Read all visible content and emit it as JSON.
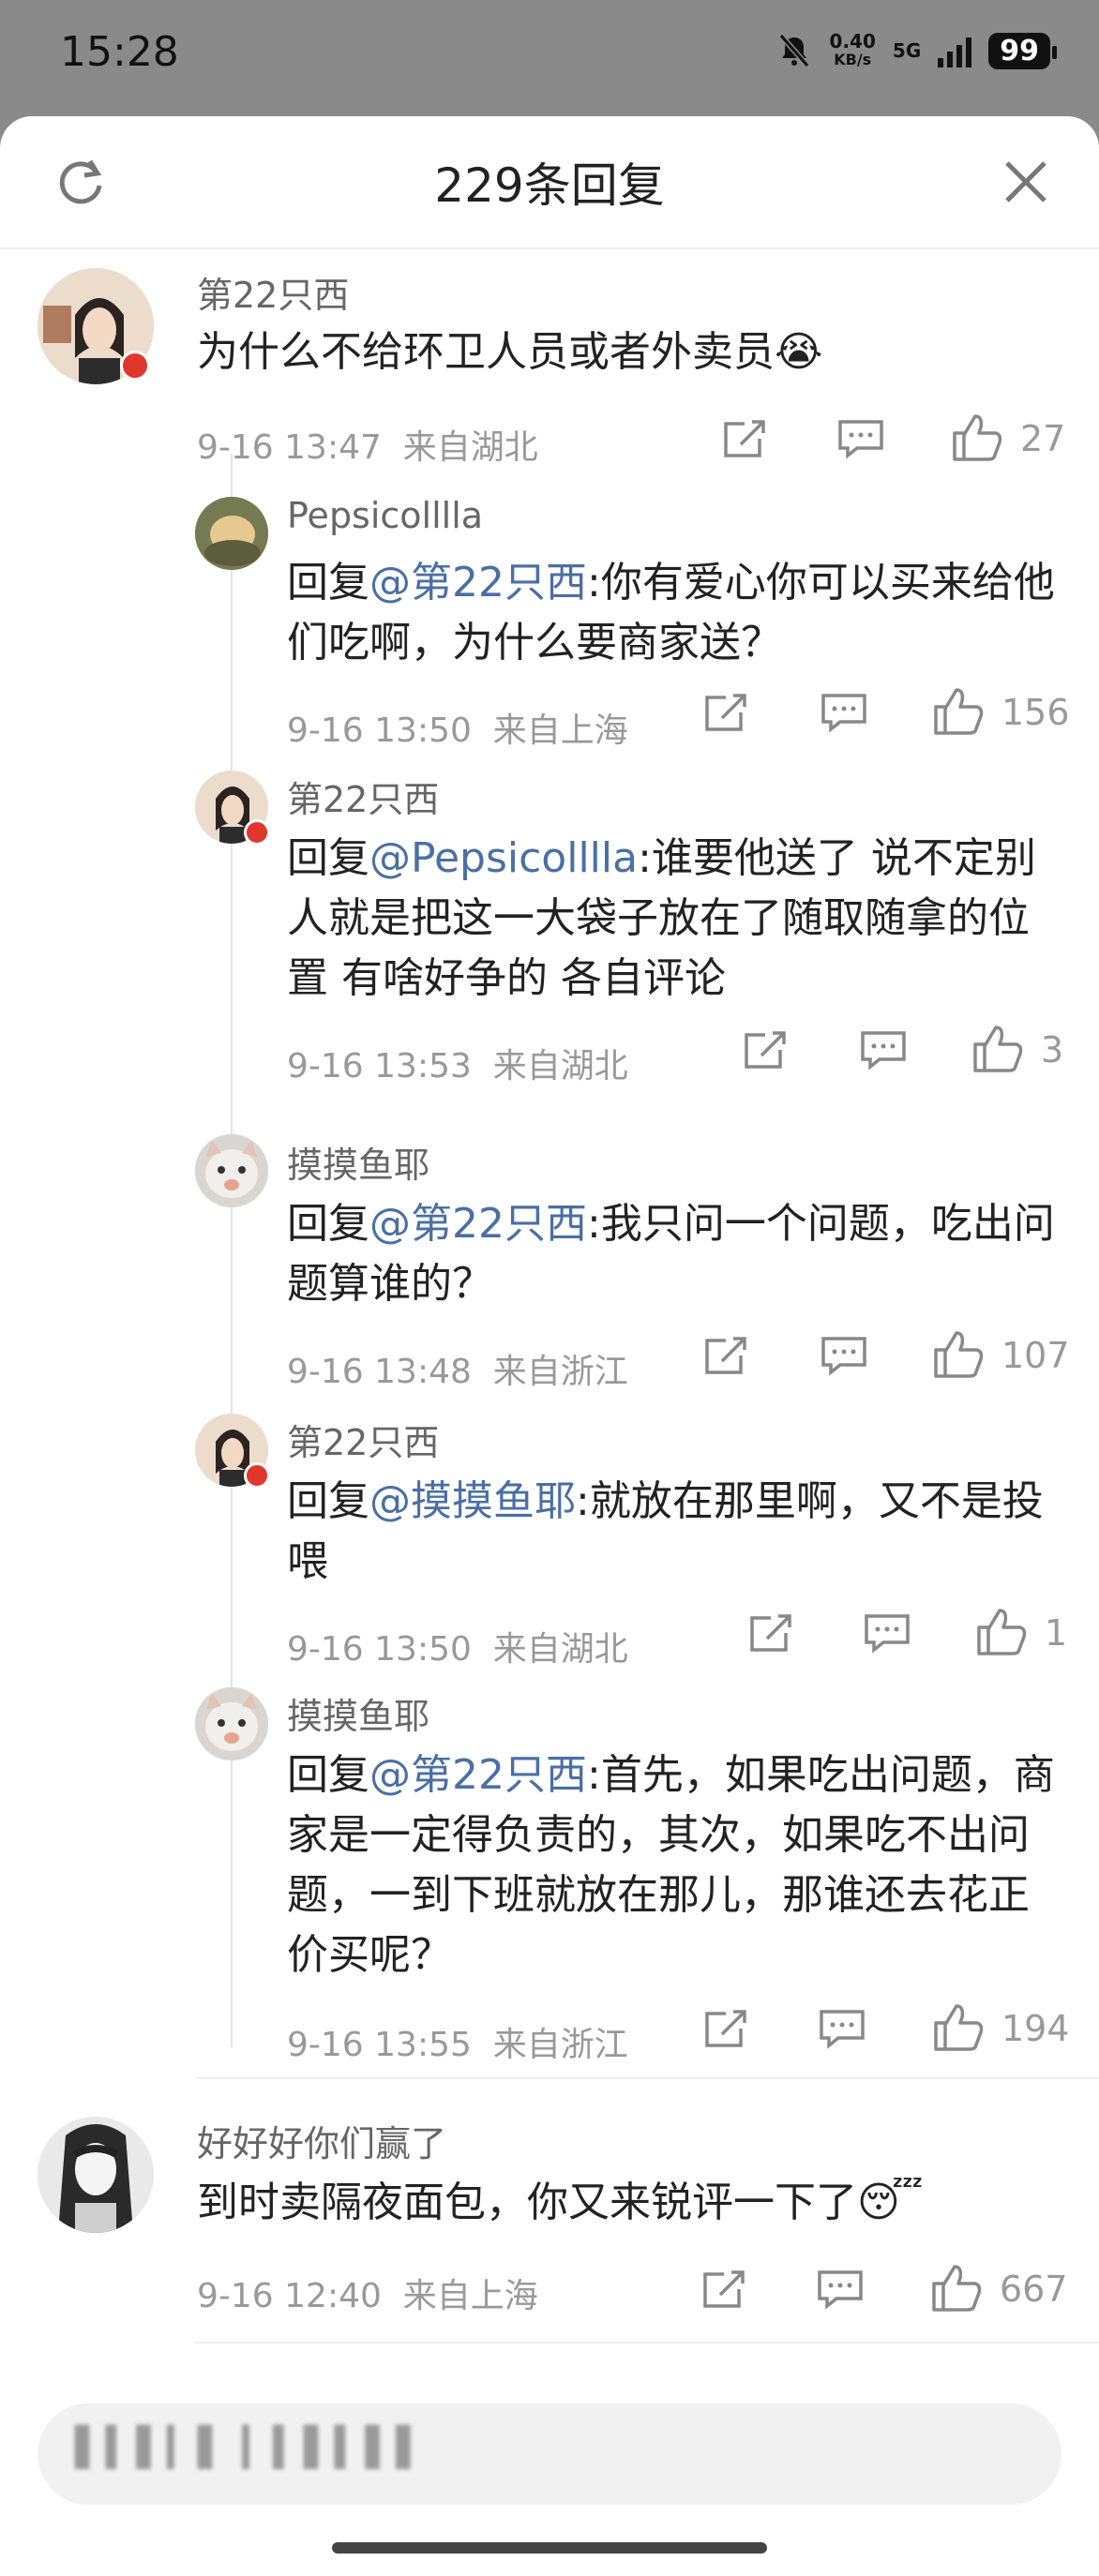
{
  "status_bar": {
    "time": "15:28",
    "speed": "0.40",
    "speed_unit": "KB/s",
    "signal": "5G",
    "battery": "99"
  },
  "header": {
    "title": "229条回复"
  },
  "comments": [
    {
      "user": "第22只西",
      "text": "为什么不给环卫人员或者外卖员😭",
      "time": "9-16 13:47",
      "location": "来自湖北",
      "likes": "27"
    },
    {
      "user": "Pepsicolllla",
      "prefix": "回复",
      "mention": "@第22只西",
      "text": ":你有爱心你可以买来给他们吃啊，为什么要商家送？",
      "time": "9-16 13:50",
      "location": "来自上海",
      "likes": "156"
    },
    {
      "user": "第22只西",
      "prefix": "回复",
      "mention": "@Pepsicolllla",
      "text": ":谁要他送了  说不定别人就是把这一大袋子放在了随取随拿的位置 有啥好争的 各自评论",
      "time": "9-16 13:53",
      "location": "来自湖北",
      "likes": "3"
    },
    {
      "user": "摸摸鱼耶",
      "prefix": "回复",
      "mention": "@第22只西",
      "text": ":我只问一个问题，吃出问题算谁的？",
      "time": "9-16 13:48",
      "location": "来自浙江",
      "likes": "107"
    },
    {
      "user": "第22只西",
      "prefix": "回复",
      "mention": "@摸摸鱼耶",
      "text": ":就放在那里啊，又不是投喂",
      "time": "9-16 13:50",
      "location": "来自湖北",
      "likes": "1"
    },
    {
      "user": "摸摸鱼耶",
      "prefix": "回复",
      "mention": "@第22只西",
      "text": ":首先，如果吃出问题，商家是一定得负责的，其次，如果吃不出问题，一到下班就放在那儿，那谁还去花正价买呢？",
      "time": "9-16 13:55",
      "location": "来自浙江",
      "likes": "194"
    },
    {
      "user": "好好好你们赢了",
      "text": "到时卖隔夜面包，你又来锐评一下了😴",
      "time": "9-16 12:40",
      "location": "来自上海",
      "likes": "667"
    }
  ],
  "input": {
    "placeholder": "▌▍▌▎▌ ▎▍▌▍▌▌"
  },
  "colors": {
    "mention": "#4a6fa5",
    "badge": "#e0362c",
    "meta": "#999999"
  }
}
